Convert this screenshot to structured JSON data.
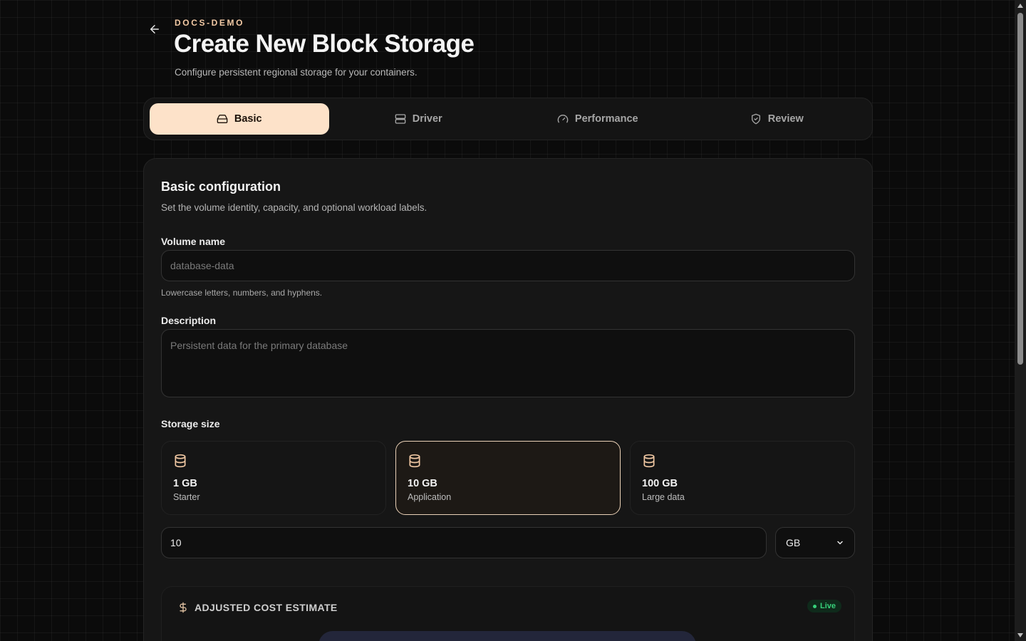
{
  "header": {
    "eyebrow": "DOCS-DEMO",
    "title": "Create New Block Storage",
    "subtitle": "Configure persistent regional storage for your containers."
  },
  "tabs": [
    {
      "label": "Basic",
      "icon": "drive-icon",
      "active": true
    },
    {
      "label": "Driver",
      "icon": "server-icon",
      "active": false
    },
    {
      "label": "Performance",
      "icon": "gauge-icon",
      "active": false
    },
    {
      "label": "Review",
      "icon": "shield-icon",
      "active": false
    }
  ],
  "section": {
    "title": "Basic configuration",
    "subtitle": "Set the volume identity, capacity, and optional workload labels."
  },
  "volume_name": {
    "label": "Volume name",
    "placeholder": "database-data",
    "hint": "Lowercase letters, numbers, and hyphens."
  },
  "description": {
    "label": "Description",
    "placeholder": "Persistent data for the primary database"
  },
  "storage_size": {
    "label": "Storage size",
    "options": [
      {
        "value": "1 GB",
        "label": "Starter",
        "selected": false
      },
      {
        "value": "10 GB",
        "label": "Application",
        "selected": true
      },
      {
        "value": "100 GB",
        "label": "Large data",
        "selected": false
      }
    ],
    "amount": "10",
    "unit": "GB"
  },
  "cost": {
    "title": "ADJUSTED COST ESTIMATE",
    "badge": "Live"
  },
  "colors": {
    "accent": "#fde2c9",
    "accent_text": "#f2c9a4",
    "live_green": "#37d07a"
  }
}
